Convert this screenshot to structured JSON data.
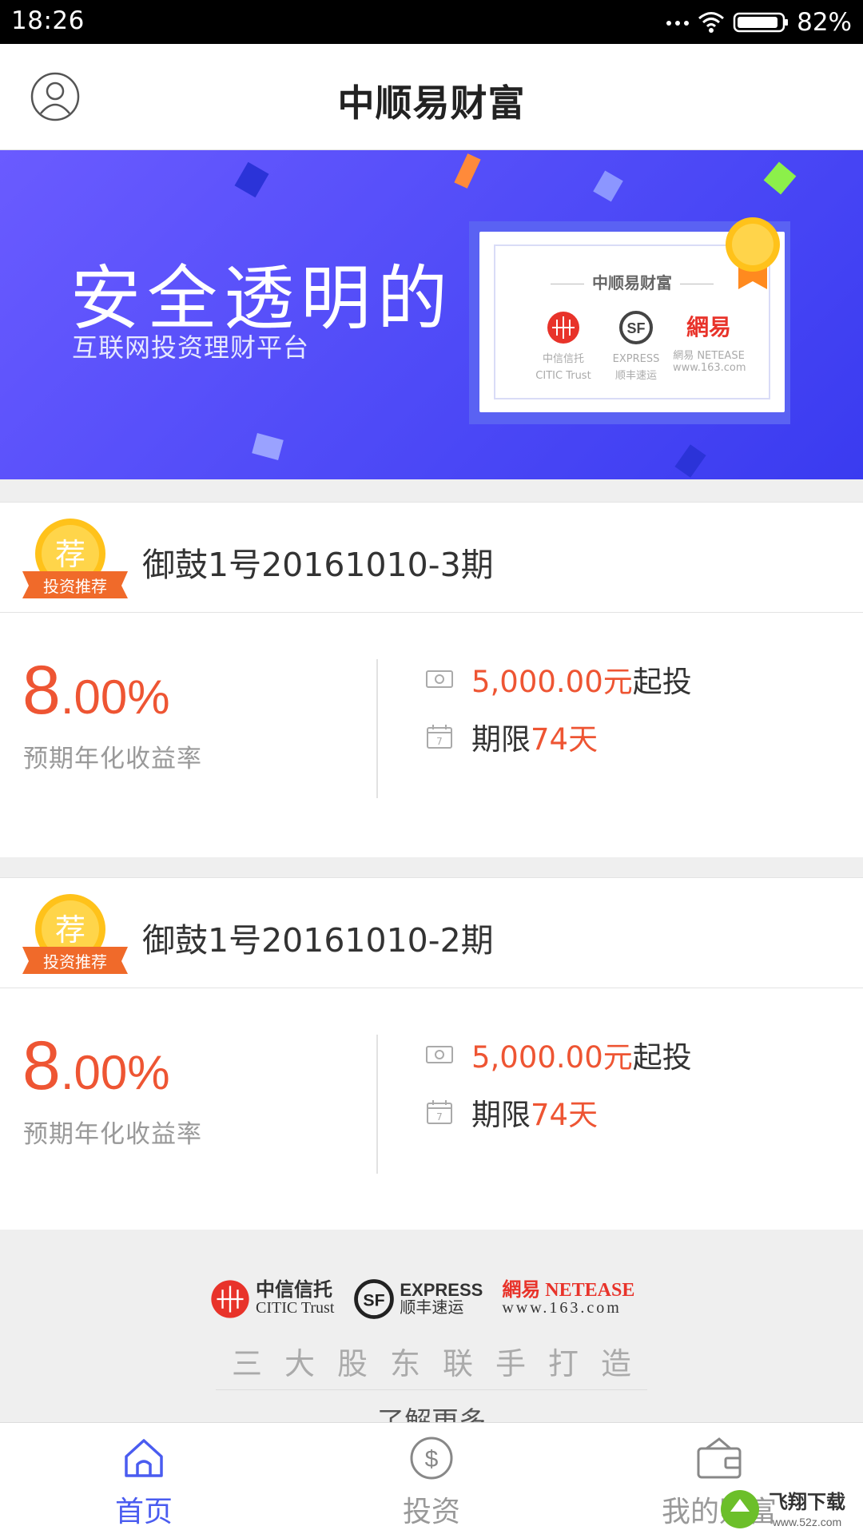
{
  "status_bar": {
    "time": "18:26",
    "battery": "82%"
  },
  "header": {
    "title": "中顺易财富"
  },
  "banner": {
    "title": "安全透明的",
    "subtitle": "互联网投资理财平台",
    "certificate": {
      "title": "中顺易财富",
      "logos": [
        {
          "name": "中信信托",
          "sub": "CITIC Trust"
        },
        {
          "name": "EXPRESS",
          "sub": "顺丰速运"
        },
        {
          "name": "網易",
          "sub": "網易 NETEASE www.163.com"
        }
      ]
    }
  },
  "products": [
    {
      "badge": "荐",
      "badge_label": "投资推荐",
      "name": "御鼓1号20161010-3期",
      "rate_int": "8",
      "rate_dec": ".00%",
      "rate_label": "预期年化收益率",
      "min_amount": "5,000.00元",
      "min_suffix": "起投",
      "term_prefix": "期限",
      "term": "74天",
      "term_icon_day": "7"
    },
    {
      "badge": "荐",
      "badge_label": "投资推荐",
      "name": "御鼓1号20161010-2期",
      "rate_int": "8",
      "rate_dec": ".00%",
      "rate_label": "预期年化收益率",
      "min_amount": "5,000.00元",
      "min_suffix": "起投",
      "term_prefix": "期限",
      "term": "74天",
      "term_icon_day": "7"
    }
  ],
  "partners": {
    "logos": [
      {
        "name": "中信信托",
        "sub": "CITIC Trust"
      },
      {
        "name": "EXPRESS",
        "sub": "顺丰速运"
      },
      {
        "name": "網易 NETEASE",
        "sub": "www.163.com"
      }
    ],
    "slogan": "三大股东联手打造",
    "more": "了解更多"
  },
  "tabbar": {
    "tabs": [
      {
        "label": "首页",
        "icon": "home-icon",
        "active": true
      },
      {
        "label": "投资",
        "icon": "dollar-icon",
        "active": false
      },
      {
        "label": "我的财富",
        "icon": "wallet-icon",
        "active": false
      }
    ]
  },
  "watermark": {
    "text": "飞翔下载",
    "url": "www.52z.com"
  },
  "colors": {
    "accent": "#4a5cf0",
    "highlight": "#ee5533",
    "banner": "#4e4af7"
  }
}
